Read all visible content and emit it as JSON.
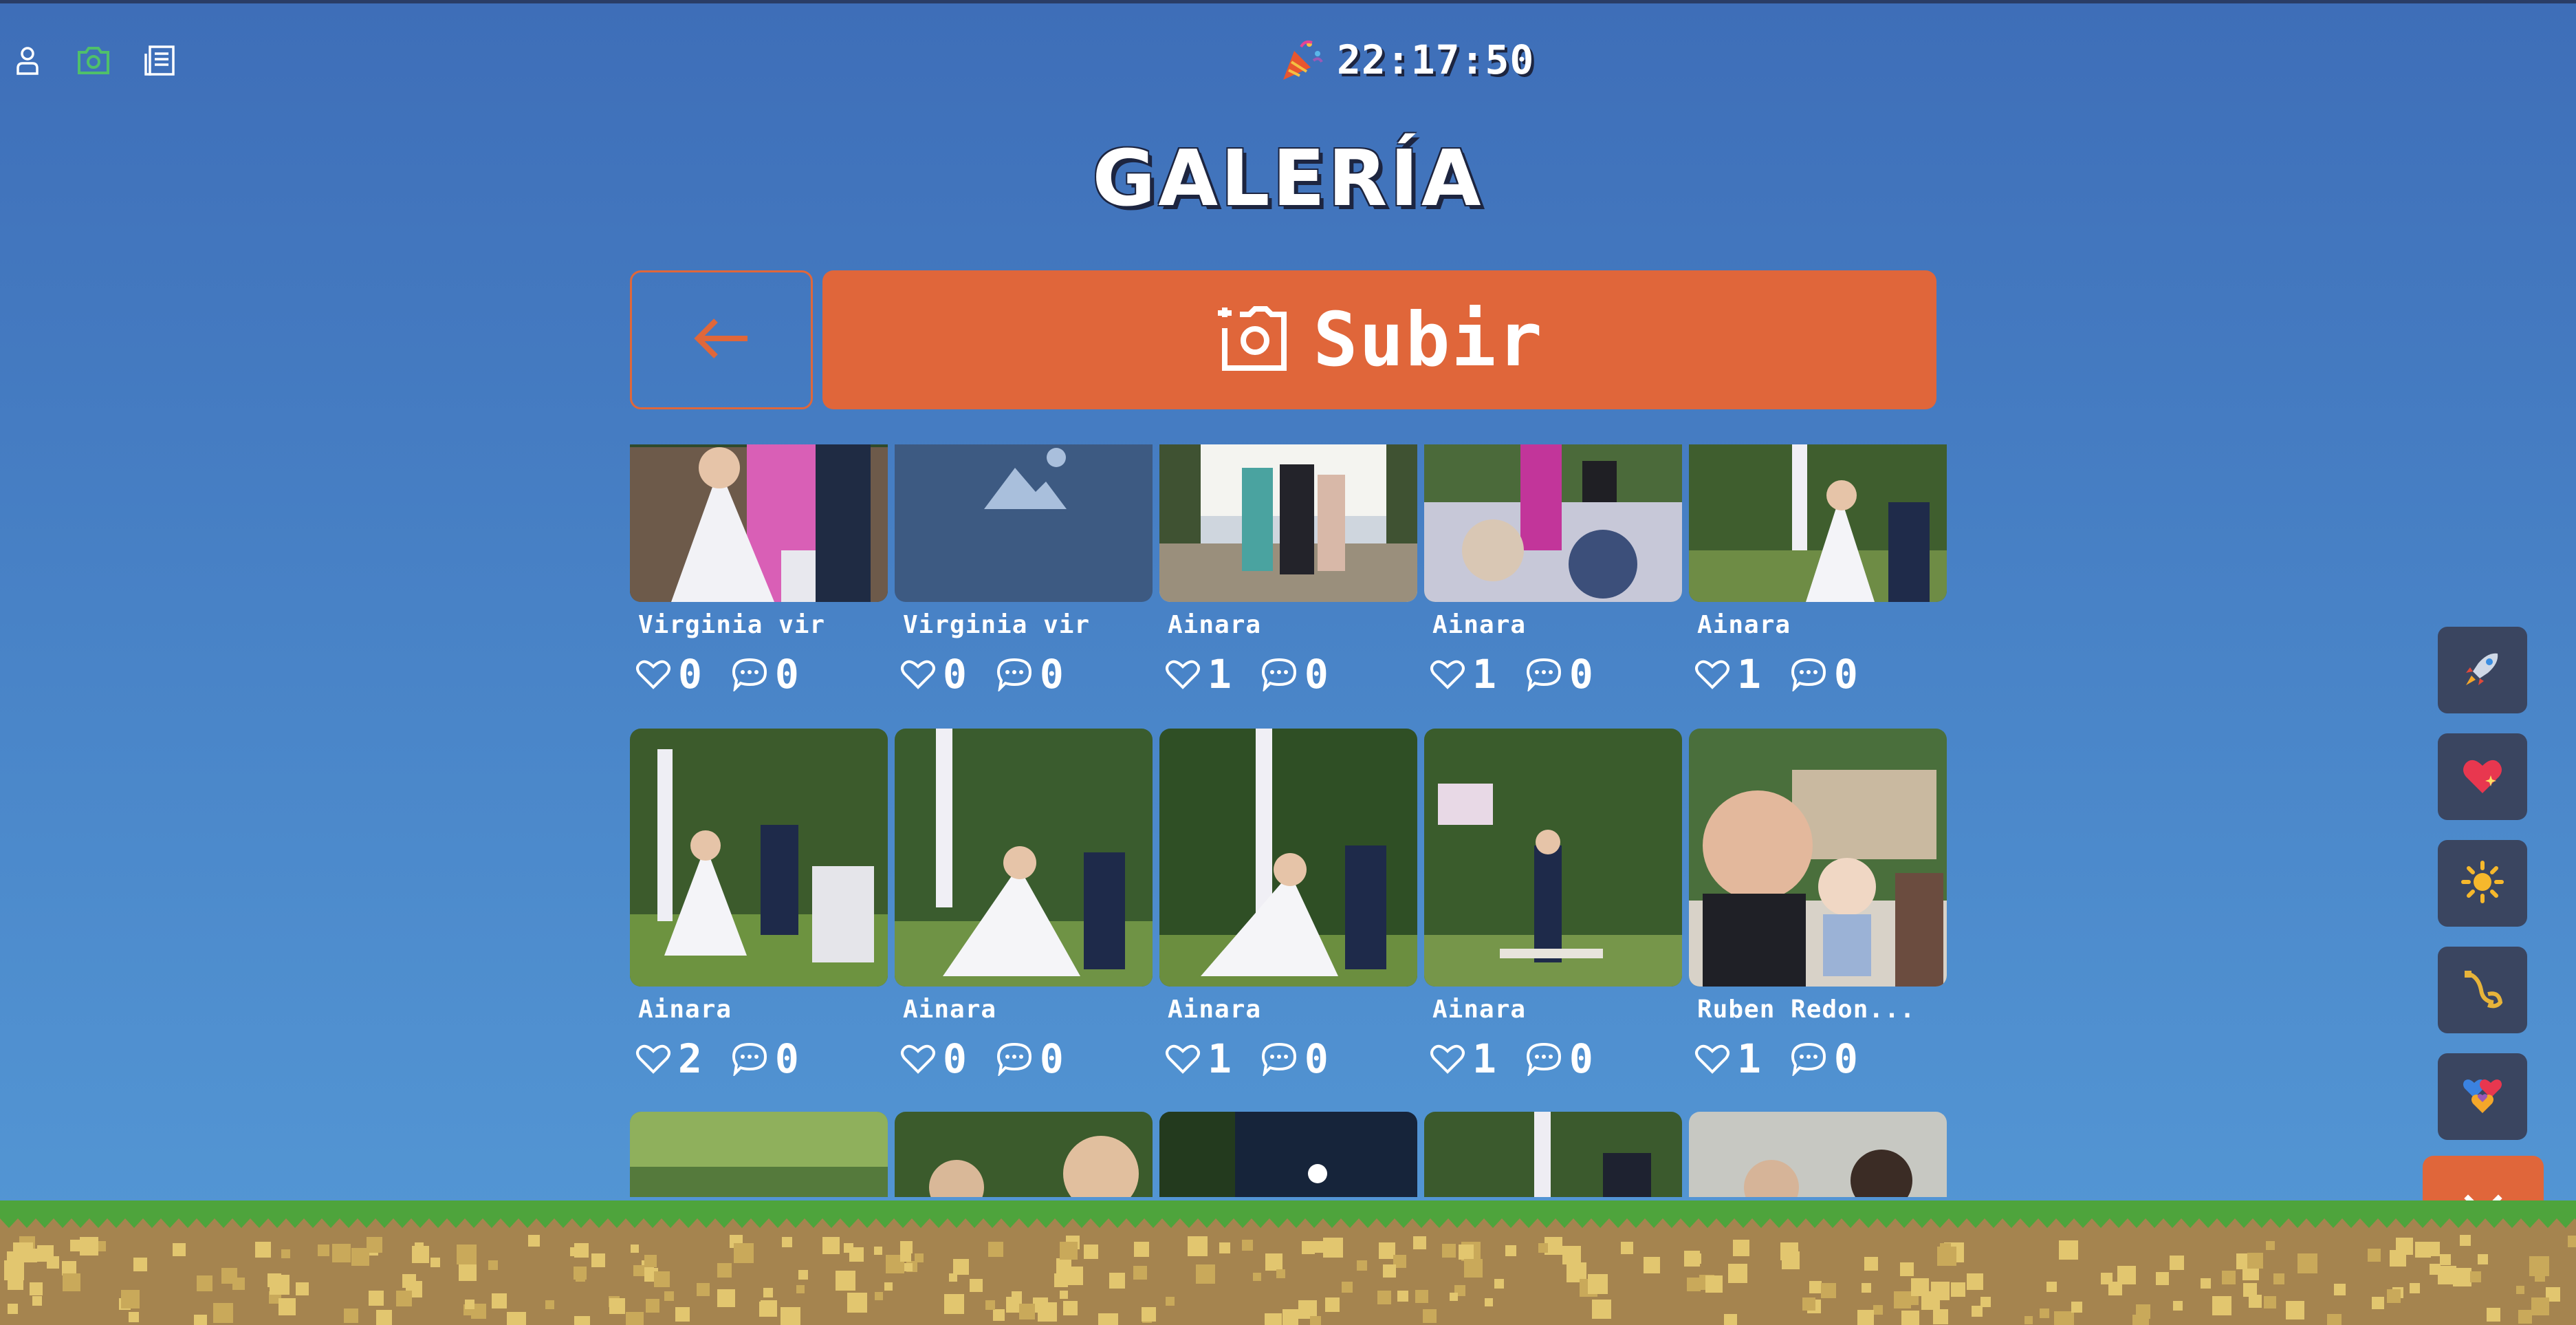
{
  "header": {
    "icons": [
      "profile-icon",
      "gallery-camera-icon",
      "news-icon"
    ],
    "timer": "22:17:50",
    "timer_icon": "party-popper-icon"
  },
  "page_title": "GALERÍA",
  "actions": {
    "back_icon": "arrow-left-icon",
    "upload_label": "Subir",
    "upload_icon": "add-photo-icon"
  },
  "gallery": {
    "rows": [
      [
        {
          "author": "Virginia vir",
          "likes": "0",
          "comments": "0"
        },
        {
          "author": "Virginia vir",
          "likes": "0",
          "comments": "0"
        },
        {
          "author": "Ainara",
          "likes": "1",
          "comments": "0"
        },
        {
          "author": "Ainara",
          "likes": "1",
          "comments": "0"
        },
        {
          "author": "Ainara",
          "likes": "1",
          "comments": "0"
        }
      ],
      [
        {
          "author": "Ainara",
          "likes": "2",
          "comments": "0"
        },
        {
          "author": "Ainara",
          "likes": "0",
          "comments": "0"
        },
        {
          "author": "Ainara",
          "likes": "1",
          "comments": "0"
        },
        {
          "author": "Ainara",
          "likes": "1",
          "comments": "0"
        },
        {
          "author": "Ruben Redon...",
          "likes": "1",
          "comments": "0"
        }
      ]
    ]
  },
  "side_actions": [
    "rocket-icon",
    "sparkling-heart-icon",
    "sun-icon",
    "horn-icon",
    "hearts-bouquet-icon"
  ],
  "close_icon": "close-icon",
  "colors": {
    "accent": "#e0663a",
    "background_top": "#3e6eb8",
    "background_bottom": "#5599d6",
    "fab": "#3a4560",
    "grass": "#4ea43c",
    "dirt": "#a5844f"
  }
}
